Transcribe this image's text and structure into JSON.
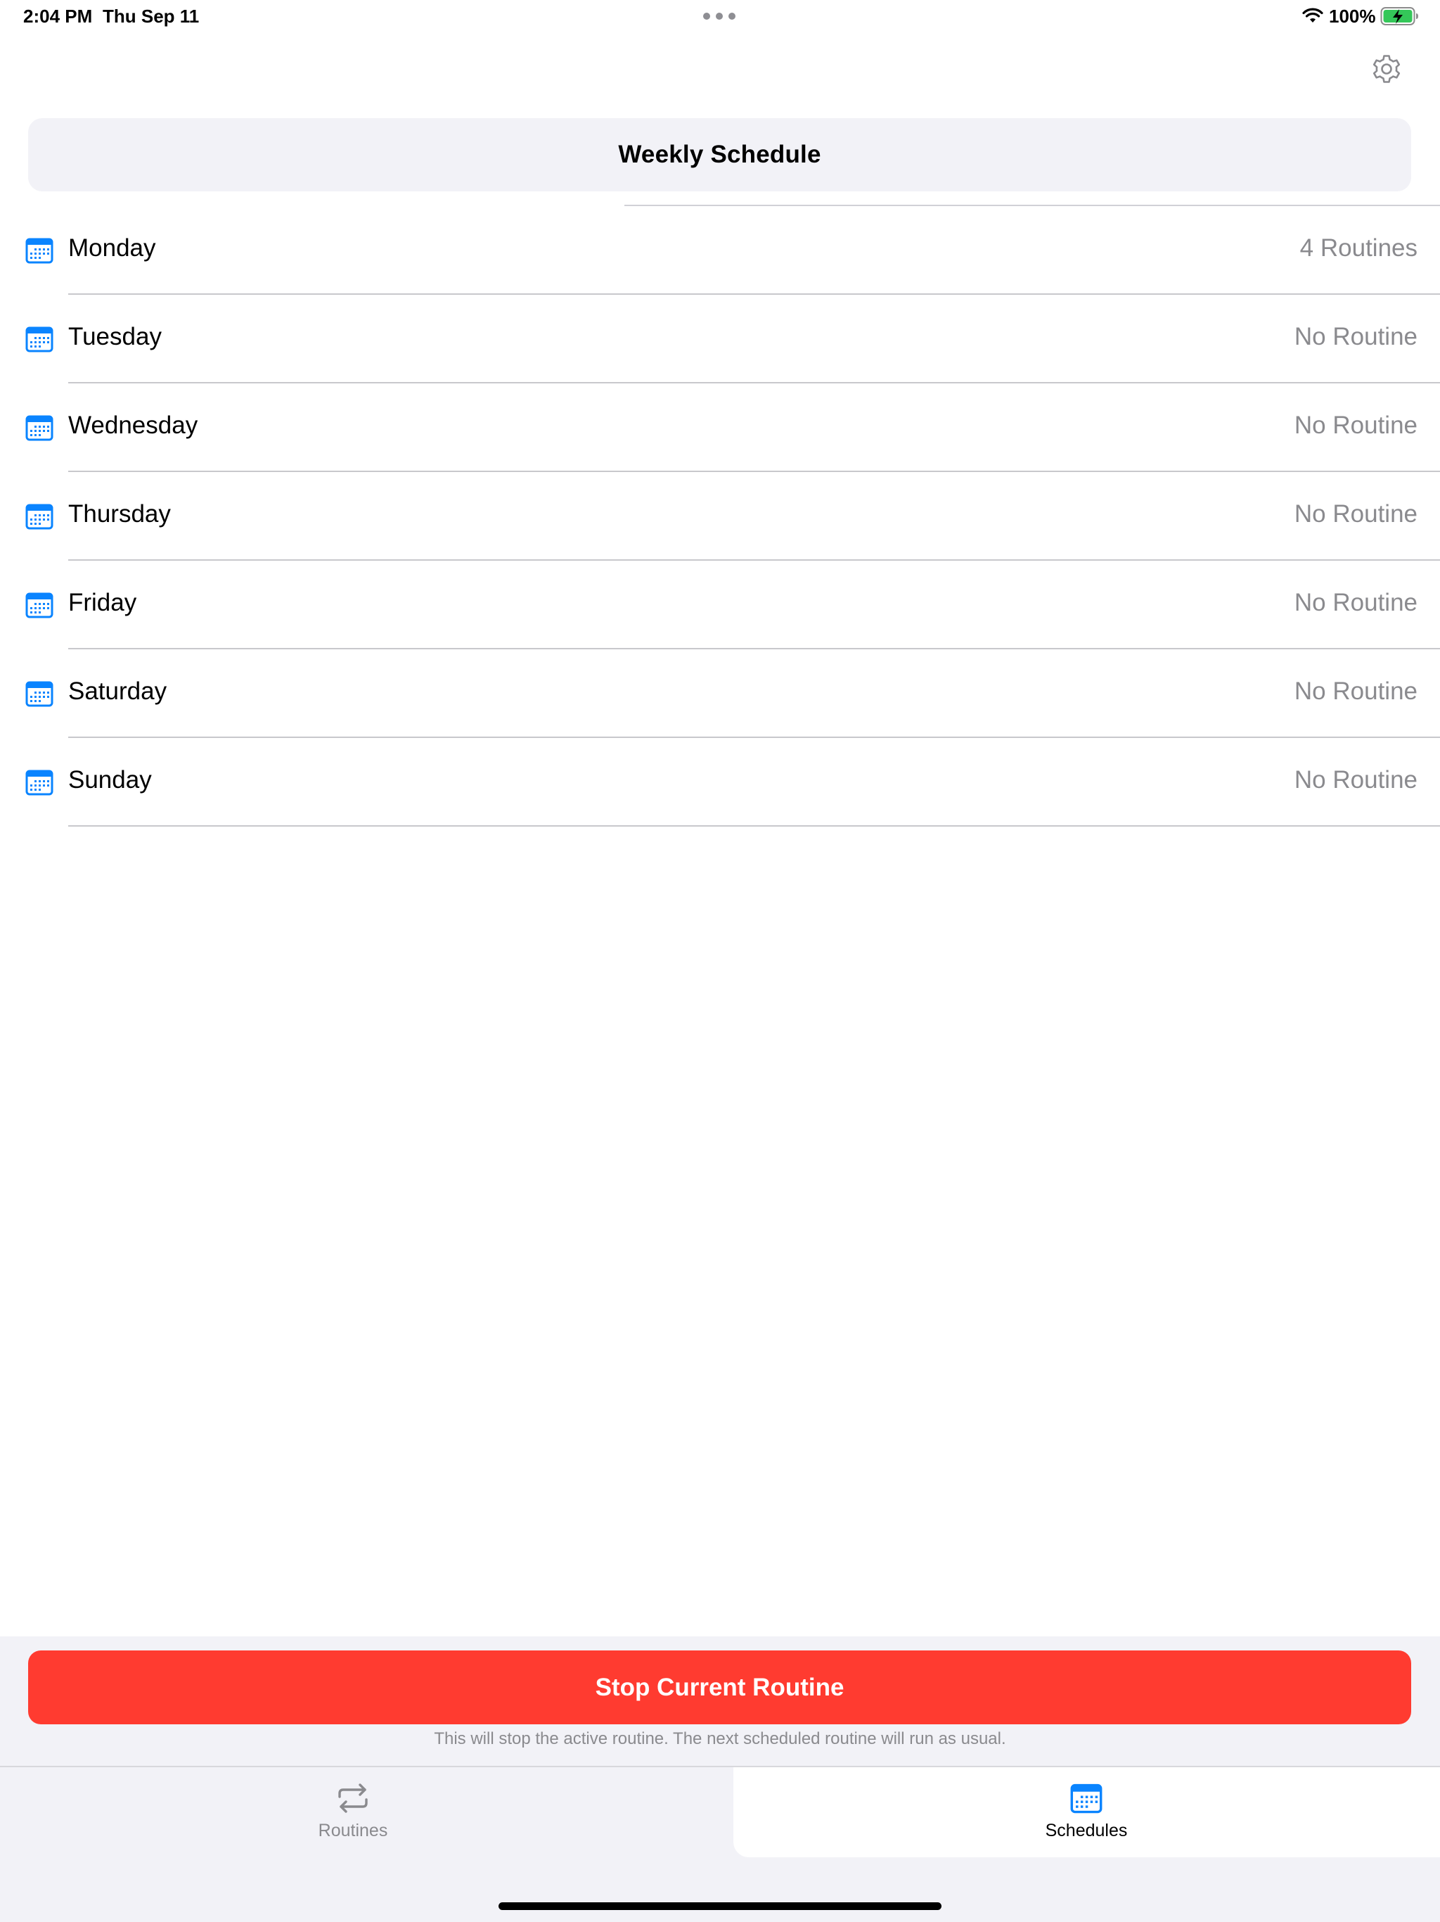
{
  "status_bar": {
    "time": "2:04 PM",
    "date": "Thu Sep 11",
    "battery_percent": "100%",
    "battery_level": 1.0,
    "charging": true
  },
  "header": {
    "title": "Weekly Schedule",
    "settings_icon": "gear-icon"
  },
  "schedule": {
    "days": [
      {
        "day": "Monday",
        "routines": "4 Routines"
      },
      {
        "day": "Tuesday",
        "routines": "No Routine"
      },
      {
        "day": "Wednesday",
        "routines": "No Routine"
      },
      {
        "day": "Thursday",
        "routines": "No Routine"
      },
      {
        "day": "Friday",
        "routines": "No Routine"
      },
      {
        "day": "Saturday",
        "routines": "No Routine"
      },
      {
        "day": "Sunday",
        "routines": "No Routine"
      }
    ],
    "row_icon": "calendar-icon"
  },
  "footer": {
    "stop_button_label": "Stop Current Routine",
    "stop_note": "This will stop the active routine. The next scheduled routine will run as usual."
  },
  "tabs": [
    {
      "label": "Routines",
      "icon": "repeat-icon",
      "selected": false
    },
    {
      "label": "Schedules",
      "icon": "calendar-icon",
      "selected": true
    }
  ],
  "colors": {
    "accent": "#0a84ff",
    "destructive": "#ff3b30",
    "secondary_text": "#8a8a8e",
    "grouped_background": "#f2f2f7",
    "battery_green": "#34c759"
  }
}
